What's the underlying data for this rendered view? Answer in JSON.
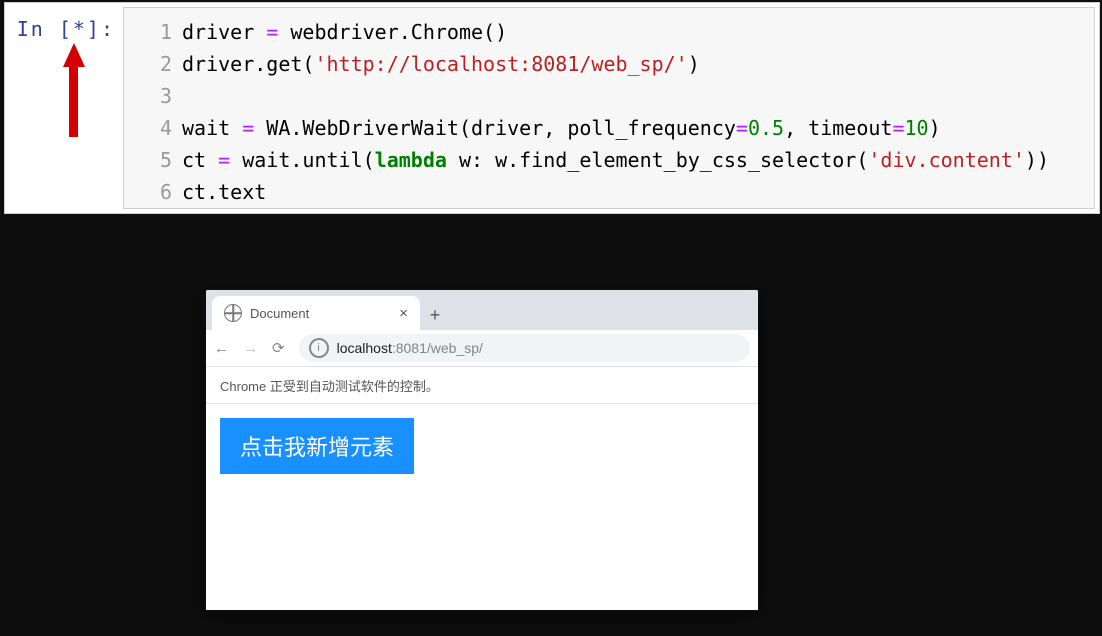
{
  "jupyter": {
    "prompt": "In [*]:",
    "line_numbers": [
      "1",
      "2",
      "3",
      "4",
      "5",
      "6"
    ],
    "code": {
      "l1_a": "driver ",
      "l1_b": "=",
      "l1_c": " webdriver.Chrome()",
      "l2_a": "driver.get(",
      "l2_s": "'http://localhost:8081/web_sp/'",
      "l2_c": ")",
      "l4_a": "wait ",
      "l4_b": "=",
      "l4_c": " WA.WebDriverWait(driver, poll_frequency",
      "l4_d": "=",
      "l4_n1": "0.5",
      "l4_e": ", timeout",
      "l4_f": "=",
      "l4_n2": "10",
      "l4_g": ")",
      "l5_a": "ct ",
      "l5_b": "=",
      "l5_c": " wait.until(",
      "l5_k": "lambda",
      "l5_d": " w: w.find_element_by_css_selector(",
      "l5_s": "'div.content'",
      "l5_e": "))",
      "l6": "ct.text"
    }
  },
  "browser": {
    "tab_title": "Document",
    "tab_close": "×",
    "new_tab": "+",
    "back": "←",
    "forward": "→",
    "reload": "⟳",
    "lock_info": "i",
    "url_host": "localhost",
    "url_port": ":8081",
    "url_path": "/web_sp/",
    "infobar": "Chrome 正受到自动测试软件的控制。",
    "button_text": "点击我新增元素"
  }
}
